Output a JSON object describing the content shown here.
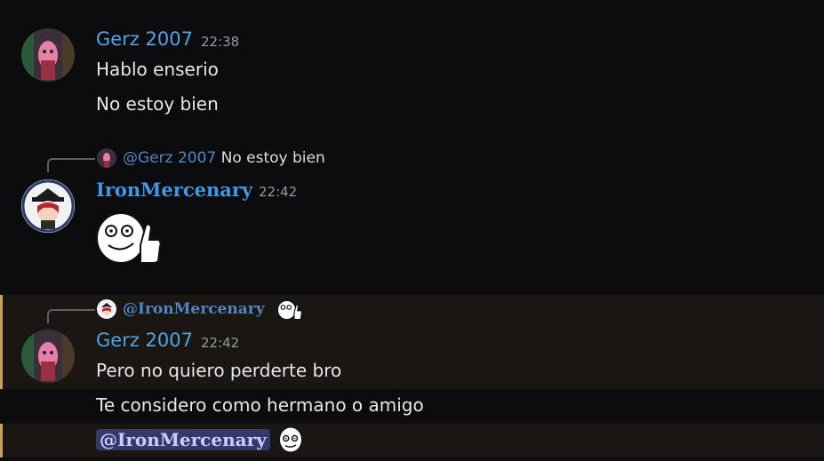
{
  "messages": [
    {
      "username": "Gerz 2007",
      "timestamp": "22:38",
      "lines": [
        "Hablo enserio",
        "No estoy bien"
      ]
    },
    {
      "reply": {
        "name": "@Gerz 2007",
        "content": "No estoy bien"
      },
      "username": "IronMercenary",
      "timestamp": "22:42",
      "sticker": "thumbs-up-troll-face"
    },
    {
      "reply": {
        "name": "@IronMercenary"
      },
      "username": "Gerz 2007",
      "timestamp": "22:42",
      "lines": [
        "Pero no quiero perderte bro",
        "Te considero como hermano o amigo"
      ],
      "mention": "@IronMercenary"
    }
  ],
  "colors": {
    "background": "#0c0c0f",
    "username_blue": "#4fa3e6",
    "highlight_bar": "#c9a15a",
    "mention_bg": "#34386b"
  }
}
